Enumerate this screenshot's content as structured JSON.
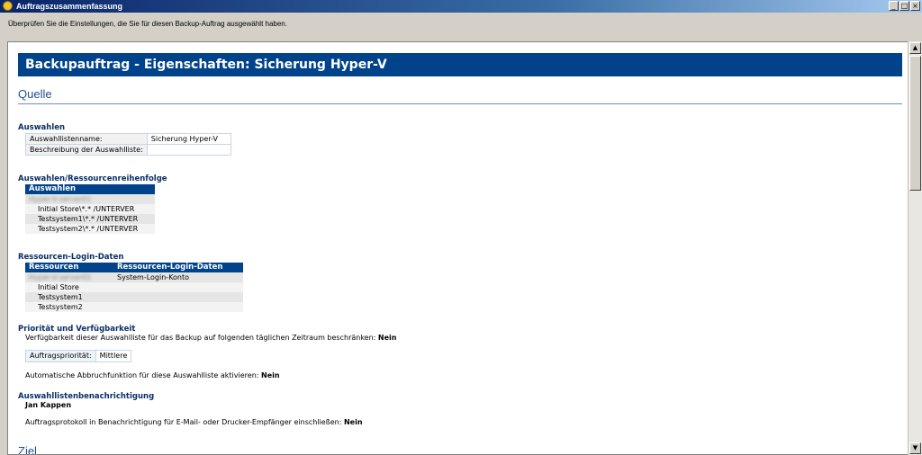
{
  "window": {
    "title": "Auftragszusammenfassung",
    "minimize": "_",
    "maximize": "□",
    "close": "×"
  },
  "instruction": "Überprüfen Sie die Einstellungen, die Sie für diesen Backup-Auftrag ausgewählt haben.",
  "header": {
    "title": "Backupauftrag - Eigenschaften: Sicherung Hyper-V"
  },
  "quelle": {
    "title": "Quelle",
    "auswahlen": {
      "heading": "Auswahlen",
      "rows": [
        {
          "key": "Auswahllistenname:",
          "value": "Sicherung Hyper-V"
        },
        {
          "key": "Beschreibung der Auswahlliste:",
          "value": ""
        }
      ]
    },
    "reihenfolge": {
      "heading": "Auswahlen/Ressourcenreihenfolge",
      "column": "Auswahlen",
      "blurred_row": "Hyper-V-server01",
      "rows": [
        "Initial Store\\*.* /UNTERVER",
        "Testsystem1\\*.* /UNTERVER",
        "Testsystem2\\*.* /UNTERVER"
      ]
    },
    "login": {
      "heading": "Ressourcen-Login-Daten",
      "columns": [
        "Ressourcen",
        "Ressourcen-Login-Daten"
      ],
      "blurred_row": "Hyper-V-server01",
      "first_login": "System-Login-Konto",
      "rows": [
        "Initial Store",
        "Testsystem1",
        "Testsystem2"
      ]
    },
    "prioritaet": {
      "heading": "Priorität und Verfügbarkeit",
      "availability_text": "Verfügbarkeit dieser Auswahlliste für das Backup auf folgenden täglichen Zeitraum beschränken:",
      "availability_value": "Nein",
      "priority_label": "Auftragspriorität:",
      "priority_value": "Mittlere",
      "abort_text": "Automatische Abbruchfunktion für diese Auswahlliste aktivieren:",
      "abort_value": "Nein"
    },
    "benachrichtigung": {
      "heading": "Auswahllistenbenachrichtigung",
      "recipient": "Jan Kappen",
      "log_text": "Auftragsprotokoll in Benachrichtigung für E-Mail- oder Drucker-Empfänger einschließen:",
      "log_value": "Nein"
    }
  },
  "ziel": {
    "title": "Ziel"
  }
}
